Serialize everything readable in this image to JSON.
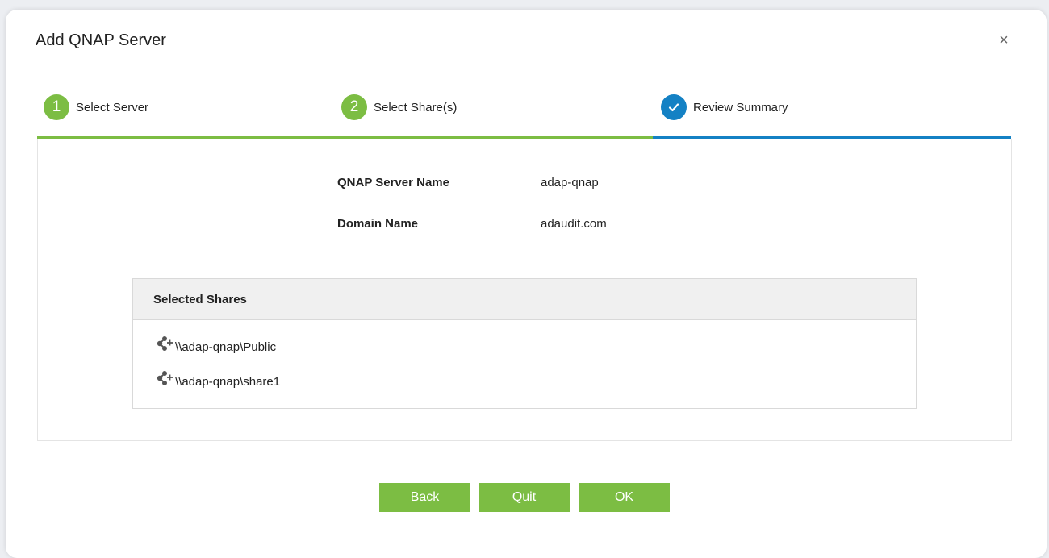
{
  "dialog": {
    "title": "Add QNAP Server",
    "close_symbol": "×"
  },
  "steps": [
    {
      "number": "1",
      "label": "Select Server",
      "state": "done"
    },
    {
      "number": "2",
      "label": "Select Share(s)",
      "state": "done"
    },
    {
      "number": "✓",
      "label": "Review Summary",
      "state": "current",
      "icon": "checkmark-icon"
    }
  ],
  "summary": {
    "server_name_label": "QNAP Server Name",
    "server_name_value": "adap-qnap",
    "domain_name_label": "Domain Name",
    "domain_name_value": "adaudit.com"
  },
  "shares": {
    "header": "Selected Shares",
    "icon": "share-network-icon",
    "items": [
      "\\\\adap-qnap\\Public",
      "\\\\adap-qnap\\share1"
    ]
  },
  "buttons": {
    "back": "Back",
    "quit": "Quit",
    "ok": "OK"
  },
  "colors": {
    "accent_green": "#7cbd43",
    "accent_blue": "#1481c4"
  }
}
